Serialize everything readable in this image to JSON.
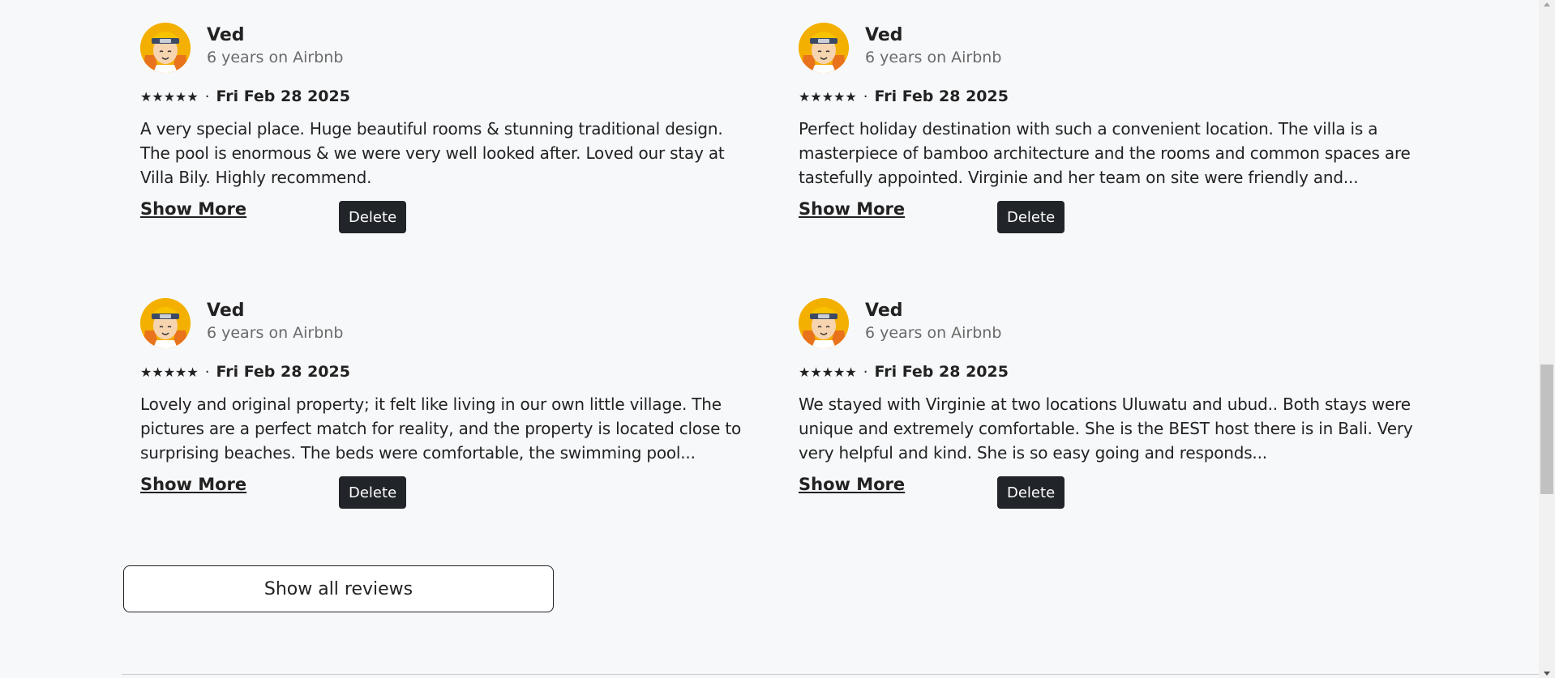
{
  "reviews": [
    {
      "name": "Ved",
      "tenure": "6 years on Airbnb",
      "stars": "★★★★★",
      "separator": "·",
      "date": "Fri Feb 28 2025",
      "text": "A very special place. Huge beautiful rooms & stunning traditional design. The pool is enormous & we were very well looked after. Loved our stay at Villa Bily. Highly recommend.",
      "show_more_label": "Show More",
      "delete_label": "Delete"
    },
    {
      "name": "Ved",
      "tenure": "6 years on Airbnb",
      "stars": "★★★★★",
      "separator": "·",
      "date": "Fri Feb 28 2025",
      "text": "Perfect holiday destination with such a convenient location. The villa is a masterpiece of bamboo architecture and the rooms and common spaces are tastefully appointed. Virginie and her team on site were friendly and...",
      "show_more_label": "Show More",
      "delete_label": "Delete"
    },
    {
      "name": "Ved",
      "tenure": "6 years on Airbnb",
      "stars": "★★★★★",
      "separator": "·",
      "date": "Fri Feb 28 2025",
      "text": "Lovely and original property; it felt like living in our own little village. The pictures are a perfect match for reality, and the property is located close to surprising beaches. The beds were comfortable, the swimming pool...",
      "show_more_label": "Show More",
      "delete_label": "Delete"
    },
    {
      "name": "Ved",
      "tenure": "6 years on Airbnb",
      "stars": "★★★★★",
      "separator": "·",
      "date": "Fri Feb 28 2025",
      "text": "We stayed with Virginie at two locations Uluwatu and ubud.. Both stays were unique and extremely comfortable. She is the BEST host there is in Bali. Very very helpful and kind. She is so easy going and responds...",
      "show_more_label": "Show More",
      "delete_label": "Delete"
    }
  ],
  "show_all_label": "Show all reviews",
  "colors": {
    "background": "#f7f8fa",
    "text": "#222222",
    "muted": "#6a6a6a",
    "delete_bg": "#212529",
    "avatar_bg": "#f4b000"
  },
  "icons": {
    "avatar": "cartoon-avatar-icon",
    "stars": "star-icon"
  }
}
